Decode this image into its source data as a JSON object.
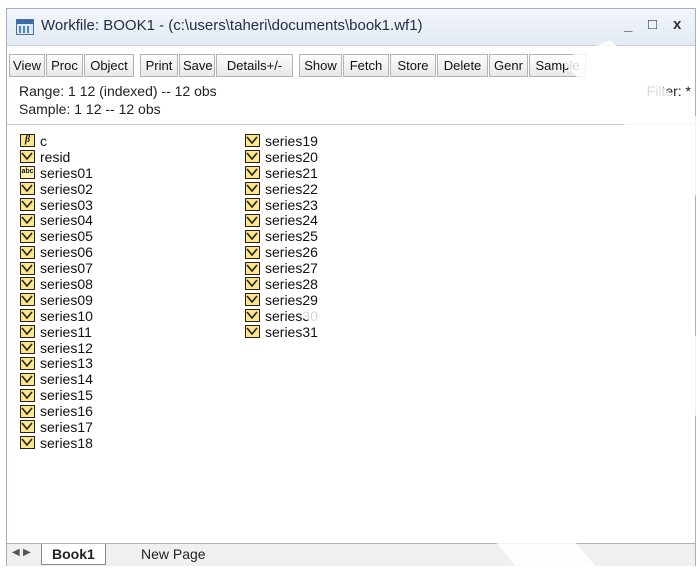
{
  "window": {
    "title": "Workfile: BOOK1 - (c:\\users\\taheri\\documents\\book1.wf1)",
    "minimize": "_",
    "maximize": "□",
    "close": "x"
  },
  "toolbar": [
    "View",
    "Proc",
    "Object",
    "Print",
    "Save",
    "Details+/-",
    "Show",
    "Fetch",
    "Store",
    "Delete",
    "Genr",
    "Sample"
  ],
  "info": {
    "range": "Range:  1 12 (indexed)  --  12 obs",
    "sample": "Sample: 1 12  --  12 obs",
    "filter": "Filter: *"
  },
  "objects_col1": [
    {
      "name": "c",
      "type": "coef"
    },
    {
      "name": "resid",
      "type": "series"
    },
    {
      "name": "series01",
      "type": "alpha"
    },
    {
      "name": "series02",
      "type": "series"
    },
    {
      "name": "series03",
      "type": "series"
    },
    {
      "name": "series04",
      "type": "series"
    },
    {
      "name": "series05",
      "type": "series"
    },
    {
      "name": "series06",
      "type": "series"
    },
    {
      "name": "series07",
      "type": "series"
    },
    {
      "name": "series08",
      "type": "series"
    },
    {
      "name": "series09",
      "type": "series"
    },
    {
      "name": "series10",
      "type": "series"
    },
    {
      "name": "series11",
      "type": "series"
    },
    {
      "name": "series12",
      "type": "series"
    },
    {
      "name": "series13",
      "type": "series"
    },
    {
      "name": "series14",
      "type": "series"
    },
    {
      "name": "series15",
      "type": "series"
    },
    {
      "name": "series16",
      "type": "series"
    },
    {
      "name": "series17",
      "type": "series"
    },
    {
      "name": "series18",
      "type": "series"
    }
  ],
  "objects_col2": [
    {
      "name": "series19",
      "type": "series"
    },
    {
      "name": "series20",
      "type": "series"
    },
    {
      "name": "series21",
      "type": "series"
    },
    {
      "name": "series22",
      "type": "series"
    },
    {
      "name": "series23",
      "type": "series"
    },
    {
      "name": "series24",
      "type": "series"
    },
    {
      "name": "series25",
      "type": "series"
    },
    {
      "name": "series26",
      "type": "series"
    },
    {
      "name": "series27",
      "type": "series"
    },
    {
      "name": "series28",
      "type": "series"
    },
    {
      "name": "series29",
      "type": "series"
    },
    {
      "name": "series30",
      "type": "series"
    },
    {
      "name": "series31",
      "type": "series"
    }
  ],
  "tabs": {
    "active": "Book1",
    "new_page": "New Page"
  },
  "icon_names": {
    "series": "series-icon",
    "coef": "coefficient-vector-icon",
    "alpha": "alpha-series-icon"
  }
}
